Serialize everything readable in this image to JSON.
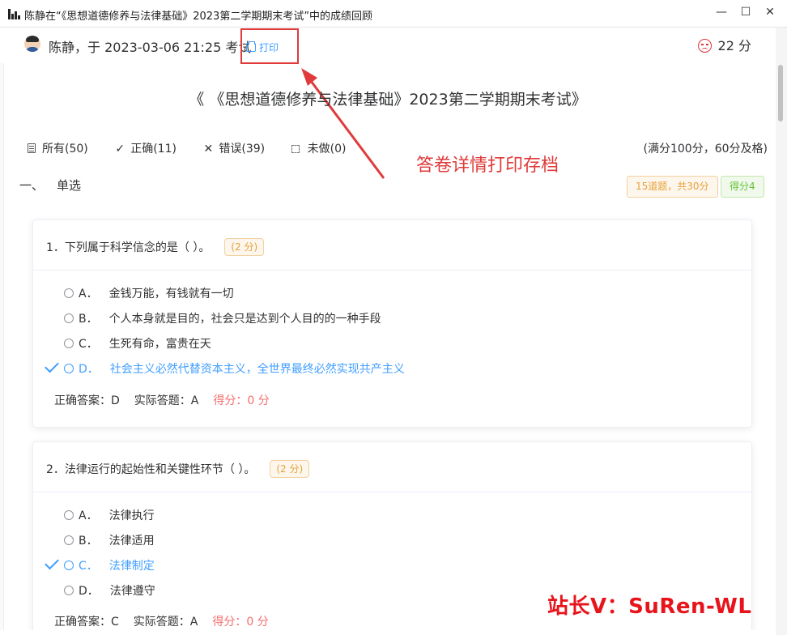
{
  "window": {
    "title": "陈静在“《思想道德修养与法律基础》2023第二学期期末考试”中的成绩回顾",
    "minimize": "—",
    "maximize": "☐",
    "close": "✕"
  },
  "header": {
    "user_line": "陈静，于 2023-03-06 21:25 考试",
    "print_label": "打印",
    "score_text": "22 分"
  },
  "exam_title": "《 《思想道德修养与法律基础》2023第二学期期末考试》",
  "filters": {
    "all": "所有(50)",
    "correct": "正确(11)",
    "wrong": "错误(39)",
    "unanswered": "未做(0)",
    "full_score": "(满分100分，60分及格)"
  },
  "annotation": "答卷详情打印存档",
  "section": {
    "number": "一、",
    "name": "单选",
    "count_tag": "15道题，共30分",
    "score_tag": "得分4"
  },
  "questions": [
    {
      "text": "1．下列属于科学信念的是（ ）。",
      "points": "(2 分)",
      "options": [
        {
          "letter": "A．",
          "text": "金钱万能，有钱就有一切"
        },
        {
          "letter": "B．",
          "text": "个人本身就是目的，社会只是达到个人目的的一种手段"
        },
        {
          "letter": "C．",
          "text": "生死有命，富贵在天"
        },
        {
          "letter": "D．",
          "text": "社会主义必然代替资本主义，全世界最终必然实现共产主义"
        }
      ],
      "correct_label": "正确答案：D",
      "actual_label": "实际答题：A",
      "score_label": "得分：0 分"
    },
    {
      "text": "2．法律运行的起始性和关键性环节（ ）。",
      "points": "(2 分)",
      "options": [
        {
          "letter": "A．",
          "text": "法律执行"
        },
        {
          "letter": "B．",
          "text": "法律适用"
        },
        {
          "letter": "C．",
          "text": "法律制定"
        },
        {
          "letter": "D．",
          "text": "法律遵守"
        }
      ],
      "correct_label": "正确答案：C",
      "actual_label": "实际答题：A",
      "score_label": "得分：0 分"
    }
  ],
  "watermark": "站长V：SuRen-WL",
  "colors": {
    "accent": "#409eff",
    "error": "#f56c6c",
    "annotation_red": "#e03a3a",
    "warning": "#e6a23c",
    "success": "#67c23a"
  }
}
